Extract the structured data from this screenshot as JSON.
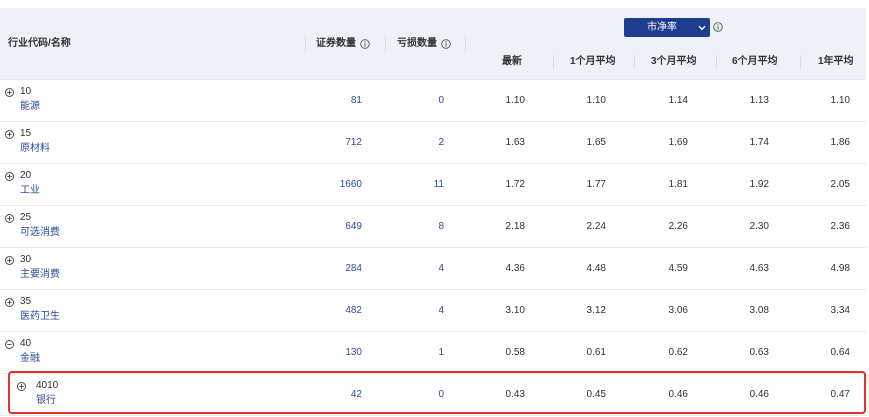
{
  "header": {
    "name_col": "行业代码/名称",
    "securities_col": "证券数量",
    "loss_col": "亏损数量",
    "metric_select": "市净率",
    "sub_cols": [
      "最新",
      "1个月平均",
      "3个月平均",
      "6个月平均",
      "1年平均"
    ]
  },
  "icons": {
    "expand": "plus-circle-icon",
    "collapse": "minus-circle-icon",
    "info": "info-icon",
    "select_arrow": "chevron-down-icon"
  },
  "colors": {
    "header_bg": "#eef1f8",
    "select_bg": "#1f3d8f",
    "link_text": "#2b4c97",
    "highlight_border": "#e3322b"
  },
  "rows": [
    {
      "code": "10",
      "name": "能源",
      "securities": "81",
      "loss": "0",
      "pb": [
        "1.10",
        "1.10",
        "1.14",
        "1.13",
        "1.10"
      ],
      "expanded": false,
      "level": 1,
      "highlighted": false
    },
    {
      "code": "15",
      "name": "原材料",
      "securities": "712",
      "loss": "2",
      "pb": [
        "1.63",
        "1.65",
        "1.69",
        "1.74",
        "1.86"
      ],
      "expanded": false,
      "level": 1,
      "highlighted": false
    },
    {
      "code": "20",
      "name": "工业",
      "securities": "1660",
      "loss": "11",
      "pb": [
        "1.72",
        "1.77",
        "1.81",
        "1.92",
        "2.05"
      ],
      "expanded": false,
      "level": 1,
      "highlighted": false
    },
    {
      "code": "25",
      "name": "可选消费",
      "securities": "649",
      "loss": "8",
      "pb": [
        "2.18",
        "2.24",
        "2.26",
        "2.30",
        "2.36"
      ],
      "expanded": false,
      "level": 1,
      "highlighted": false
    },
    {
      "code": "30",
      "name": "主要消费",
      "securities": "284",
      "loss": "4",
      "pb": [
        "4.36",
        "4.48",
        "4.59",
        "4.63",
        "4.98"
      ],
      "expanded": false,
      "level": 1,
      "highlighted": false
    },
    {
      "code": "35",
      "name": "医药卫生",
      "securities": "482",
      "loss": "4",
      "pb": [
        "3.10",
        "3.12",
        "3.06",
        "3.08",
        "3.34"
      ],
      "expanded": false,
      "level": 1,
      "highlighted": false
    },
    {
      "code": "40",
      "name": "金融",
      "securities": "130",
      "loss": "1",
      "pb": [
        "0.58",
        "0.61",
        "0.62",
        "0.63",
        "0.64"
      ],
      "expanded": true,
      "level": 1,
      "highlighted": false
    },
    {
      "code": "4010",
      "name": "银行",
      "securities": "42",
      "loss": "0",
      "pb": [
        "0.43",
        "0.45",
        "0.46",
        "0.46",
        "0.47"
      ],
      "expanded": false,
      "level": 2,
      "highlighted": true
    }
  ]
}
